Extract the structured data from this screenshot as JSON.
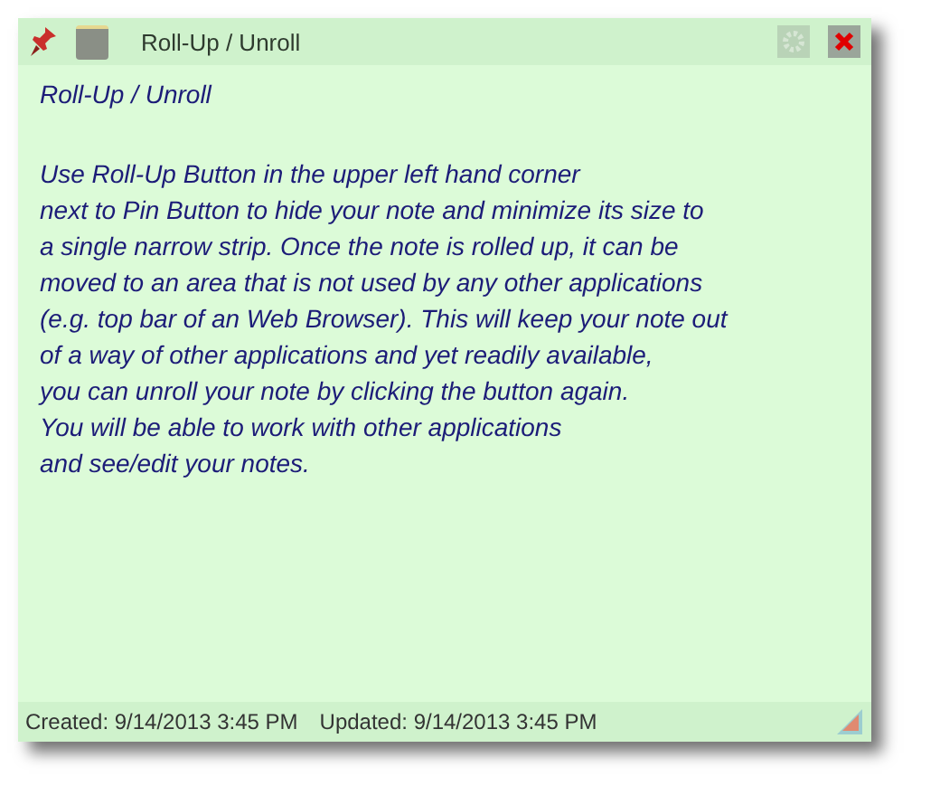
{
  "window": {
    "title": "Roll-Up / Unroll"
  },
  "note": {
    "heading": "Roll-Up / Unroll",
    "lines": [
      "Use Roll-Up Button in the upper left hand corner",
      "next to Pin Button to hide your note and minimize its size to",
      "a single narrow strip. Once the note is rolled up, it can be",
      "moved to an area that is not used by any other applications",
      "(e.g. top bar of an Web Browser). This will keep your note out",
      "of a way of other applications and yet readily available,",
      "you can unroll your note by clicking the button again.",
      "You will be able to work with other applications",
      "and see/edit your notes."
    ]
  },
  "status_bar": {
    "created": "Created: 9/14/2013 3:45 PM",
    "updated": "Updated: 9/14/2013 3:45 PM"
  }
}
